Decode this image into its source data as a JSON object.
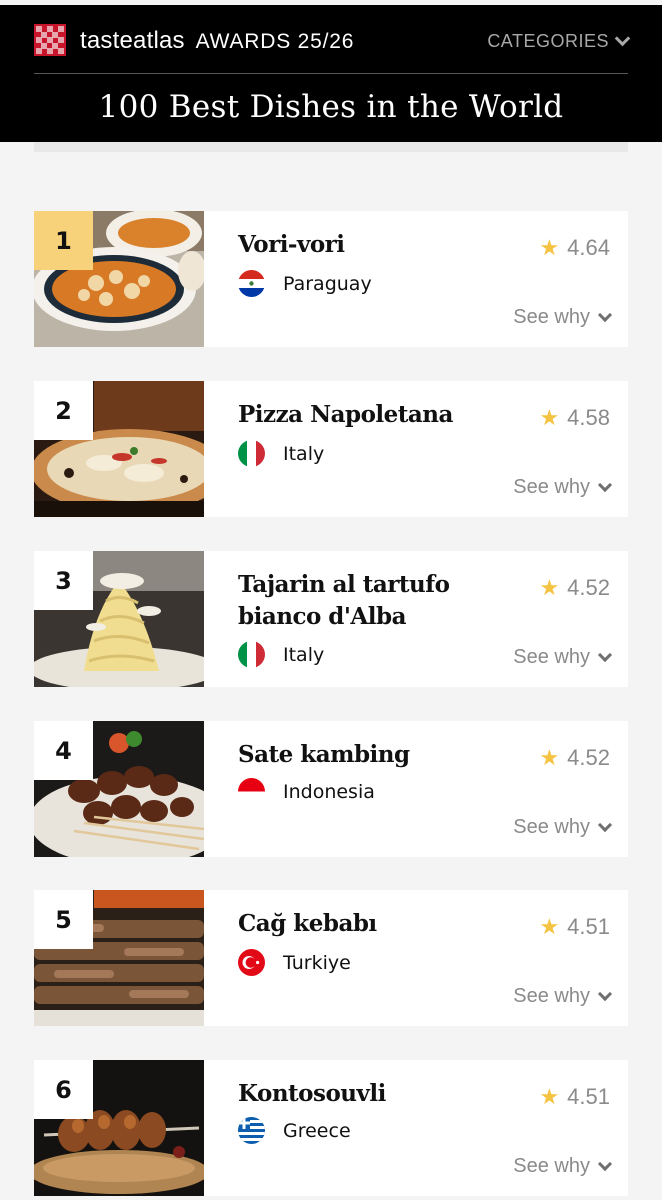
{
  "header": {
    "brand_part1": "tasteatlas",
    "brand_part2": "AWARDS 25/26",
    "categories_label": "CATEGORIES",
    "title": "100 Best Dishes in the World"
  },
  "colors": {
    "accent_gold": "#f8d27a",
    "star": "#f5c342",
    "brand_red": "#c7162b"
  },
  "dishes": [
    {
      "rank": "1",
      "name": "Vori-vori",
      "country": "Paraguay",
      "rating": "4.64",
      "see_why": "See why"
    },
    {
      "rank": "2",
      "name": "Pizza Napoletana",
      "country": "Italy",
      "rating": "4.58",
      "see_why": "See why"
    },
    {
      "rank": "3",
      "name": "Tajarin al tartufo bianco d'Alba",
      "country": "Italy",
      "rating": "4.52",
      "see_why": "See why"
    },
    {
      "rank": "4",
      "name": "Sate kambing",
      "country": "Indonesia",
      "rating": "4.52",
      "see_why": "See why"
    },
    {
      "rank": "5",
      "name": "Cağ kebabı",
      "country": "Turkiye",
      "rating": "4.51",
      "see_why": "See why"
    },
    {
      "rank": "6",
      "name": "Kontosouvli",
      "country": "Greece",
      "rating": "4.51",
      "see_why": "See why"
    }
  ]
}
